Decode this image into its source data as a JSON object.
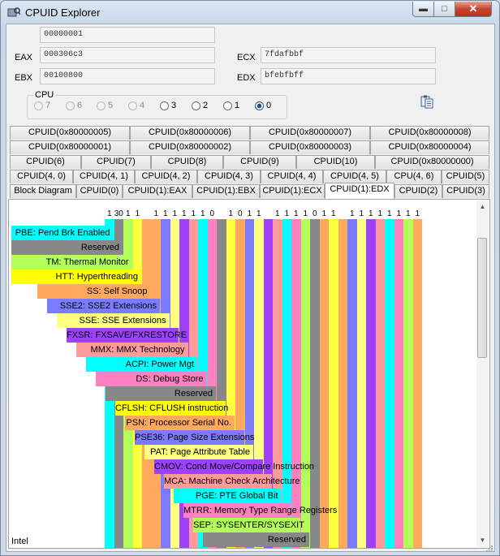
{
  "window": {
    "title": "CPUID Explorer",
    "minimize_icon": "minimize-icon",
    "maximize_icon": "maximize-icon",
    "close_icon": "close-icon"
  },
  "registers": {
    "leaf_value": "00000001",
    "eax": {
      "label": "EAX",
      "value": "000306c3"
    },
    "ebx": {
      "label": "EBX",
      "value": "00100800"
    },
    "ecx": {
      "label": "ECX",
      "value": "7fdafbbf"
    },
    "edx": {
      "label": "EDX",
      "value": "bfebfbff"
    }
  },
  "cpu_selector": {
    "label": "CPU",
    "options": [
      "7",
      "6",
      "5",
      "4",
      "3",
      "2",
      "1",
      "0"
    ],
    "enabled": [
      "3",
      "2",
      "1",
      "0"
    ],
    "selected": "0"
  },
  "copy_button": {
    "icon": "clipboard-icon"
  },
  "tabs": {
    "row1": [
      "CPUID(0x80000005)",
      "CPUID(0x80000006)",
      "CPUID(0x80000007)",
      "CPUID(0x80000008)"
    ],
    "row2": [
      "CPUID(0x80000001)",
      "CPUID(0x80000002)",
      "CPUID(0x80000003)",
      "CPUID(0x80000004)"
    ],
    "row3": [
      "CPUID(6)",
      "CPUID(7)",
      "CPUID(8)",
      "CPUID(9)",
      "CPUID(10)",
      "CPUID(0x80000000)"
    ],
    "row4": [
      "CPUID(4, 0)",
      "CPUID(4, 1)",
      "CPUID(4, 2)",
      "CPUID(4, 3)",
      "CPUID(4, 4)",
      "CPUID(4, 5)",
      "CPU(4, 6)",
      "CPUID(5)"
    ],
    "row5": [
      "Block Diagram",
      "CPUID(0)",
      "CPUID(1):EAX",
      "CPUID(1):EBX",
      "CPUID(1):ECX",
      "CPUID(1):EDX",
      "CPUID(2)",
      "CPUID(3)"
    ],
    "active": "CPUID(1):EDX"
  },
  "edx_diagram": {
    "bit_values": [
      "1",
      "30",
      "1",
      "1",
      "",
      "1",
      "1",
      "1",
      "1",
      "1",
      "1",
      "0",
      "",
      "1",
      "0",
      "1",
      "1",
      "",
      "1",
      "1",
      "1",
      "1",
      "0",
      "1",
      "1",
      "",
      "1",
      "1",
      "1",
      "1",
      "1",
      "1",
      "1",
      "1"
    ],
    "bit_colors": [
      "#00ffff",
      "#888888",
      "#b2ff59",
      "#ffff40",
      "#ffa95e",
      "#ffa95e",
      "#7b7bff",
      "#ffff80",
      "#a040ff",
      "#ff9a9a",
      "#00ffff",
      "#ff80c0",
      "#888888",
      "#ffff40",
      "#ffa95e",
      "#7b7bff",
      "#ffff80",
      "#a040ff",
      "#ff9a9a",
      "#00ffff",
      "#ff80c0",
      "#b2ff59",
      "#888888",
      "#ffa95e",
      "#ffff40",
      "#ffa95e",
      "#7b7bff",
      "#ffff80",
      "#a040ff",
      "#ff9a9a",
      "#00ffff",
      "#ff80c0",
      "#b2ff59",
      "#ffa95e"
    ],
    "labels": [
      {
        "text": "PBE: Pend Brk Enabled",
        "color": "#00ffff"
      },
      {
        "text": "Reserved",
        "color": "#888888"
      },
      {
        "text": "TM: Thermal Monitor",
        "color": "#b2ff59"
      },
      {
        "text": "HTT: Hyperthreading",
        "color": "#ffff00"
      },
      {
        "text": "SS: Self Snoop",
        "color": "#ffa95e"
      },
      {
        "text": "SSE2: SSE2 Extensions",
        "color": "#7b7bff"
      },
      {
        "text": "SSE: SSE Extensions",
        "color": "#ffff80"
      },
      {
        "text": "FXSR: FXSAVE/FXRESTORE",
        "color": "#a040ff"
      },
      {
        "text": "MMX: MMX Technology",
        "color": "#ff9a9a"
      },
      {
        "text": "ACPI: Power Mgt",
        "color": "#00ffff"
      },
      {
        "text": "DS: Debug Store",
        "color": "#ff80c0"
      },
      {
        "text": "Reserved",
        "color": "#888888"
      },
      {
        "text": "CFLSH: CFLUSH instruction",
        "color": "#ffff00"
      },
      {
        "text": "PSN: Processor Serial No.",
        "color": "#ffa95e"
      },
      {
        "text": "PSE36: Page Size Extensions",
        "color": "#7b7bff"
      },
      {
        "text": "PAT: Page Attribute Table",
        "color": "#ffff80"
      },
      {
        "text": "CMOV: Cond Move/Compare Instruction",
        "color": "#a040ff"
      },
      {
        "text": "MCA: Machine Check Architecture",
        "color": "#ff9a9a"
      },
      {
        "text": "PGE: PTE Global Bit",
        "color": "#00ffff"
      },
      {
        "text": "MTRR: Memory Type Range Registers",
        "color": "#ff80c0"
      },
      {
        "text": "SEP: SYSENTER/SYSEXIT",
        "color": "#b2ff59"
      },
      {
        "text": "Reserved",
        "color": "#888888"
      }
    ]
  },
  "status": {
    "cpu_vendor": "Intel"
  }
}
